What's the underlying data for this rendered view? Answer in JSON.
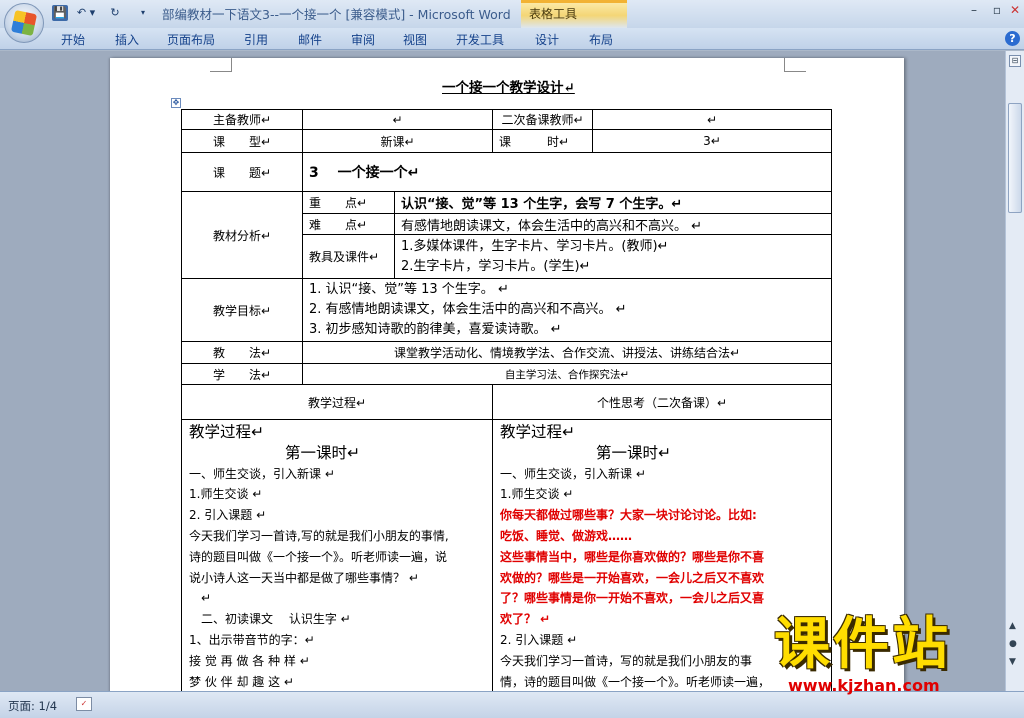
{
  "window": {
    "title": "部编教材一下语文3--一个接一个 [兼容模式] - Microsoft Word",
    "contextual_group": "表格工具"
  },
  "qat": {
    "save": "💾",
    "undo": "↶ ▾",
    "redo": "↻",
    "more": "▾"
  },
  "window_controls": {
    "minimize": "–",
    "maximize": "▫",
    "close": "✕"
  },
  "ribbon_tabs": [
    "开始",
    "插入",
    "页面布局",
    "引用",
    "邮件",
    "审阅",
    "视图",
    "开发工具",
    "设计",
    "布局"
  ],
  "help": "?",
  "document": {
    "heading": "一个接一个教学设计↵",
    "table_handle": "✥",
    "rows": {
      "main_teacher_label": "主备教师↵",
      "main_teacher_value": "↵",
      "second_teacher_label": "二次备课教师↵",
      "second_teacher_value": "↵",
      "type_label": "课　　型↵",
      "type_value": "新课↵",
      "hours_label": "课　　　时↵",
      "hours_value": "3↵",
      "topic_label": "课　　题↵",
      "topic_value": "3　 一个接一个↵",
      "analysis_label": "教材分析↵",
      "key_label": "重　　点↵",
      "key_value": "认识“接、觉”等 13 个生字，会写 7 个生字。↵",
      "diff_label": "难　　点↵",
      "diff_value": "有感情地朗读课文，体会生活中的高兴和不高兴。 ↵",
      "tools_label": "教具及课件↵",
      "tools_line1": "1.多媒体课件，生字卡片、学习卡片。(教师)↵",
      "tools_line2": "2.生字卡片，学习卡片。(学生)↵",
      "goals_label": "教学目标↵",
      "goals": [
        "1. 认识“接、觉”等 13 个生字。 ↵",
        "2. 有感情地朗读课文，体会生活中的高兴和不高兴。 ↵",
        "3. 初步感知诗歌的韵律美，喜爱读诗歌。 ↵"
      ],
      "method_label": "教　　法↵",
      "method_value": "课堂教学活动化、情境教学法、合作交流、讲授法、讲练结合法↵",
      "learn_label": "学　　法↵",
      "learn_value": "自主学习法、合作探究法↵",
      "process_header": "教学过程↵",
      "personal_header": "个性思考（二次备课）↵"
    },
    "process_left": [
      "教学过程↵",
      "第一课时↵",
      "一、师生交谈，引入新课 ↵",
      "1.师生交谈 ↵",
      "2. 引入课题 ↵",
      "今天我们学习一首诗,写的就是我们小朋友的事情,",
      "诗的题目叫做《一个接一个》。听老师读一遍，说",
      "说小诗人这一天当中都是做了哪些事情？ ↵",
      "↵",
      "二、初读课文　 认识生字 ↵",
      "1、出示带音节的字：↵",
      "接 觉 再 做 各 种 样 ↵",
      "梦 伙 伴 却 趣 这 ↵"
    ],
    "process_right": [
      "教学过程↵",
      "第一课时↵",
      "一、师生交谈，引入新课 ↵",
      "1.师生交谈 ↵",
      "你每天都做过哪些事？大家一块讨论讨论。比如:",
      "吃饭、睡觉、做游戏……",
      "这些事情当中，哪些是你喜欢做的？哪些是你不喜",
      "欢做的？哪些是一开始喜欢，一会儿之后又不喜欢",
      "了？哪些事情是你一开始不喜欢，一会儿之后又喜",
      "欢了？ ↵",
      "2. 引入课题 ↵",
      "今天我们学习一首诗，写的就是我们小朋友的事",
      "情，诗的题目叫做《一个接一个》。听老师读一遍，"
    ]
  },
  "statusbar": {
    "page": "页面: 1/4"
  },
  "scrollbar": {
    "split": "⊟",
    "prev": "▲",
    "select": "●",
    "next": "▼"
  },
  "watermark": {
    "main": "课件站",
    "url": "www.kjzhan.com"
  }
}
